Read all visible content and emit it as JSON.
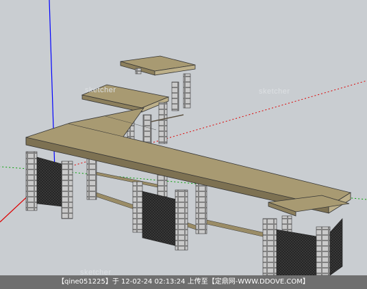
{
  "scene": {
    "background_color": "#c9cdd1",
    "wood_color": "#a89a72",
    "brick_color": "#bcbcbc",
    "mesh_color": "#2e2e2e",
    "axis_colors": {
      "blue": "#0000ff",
      "green": "#00a000",
      "red": "#dd0000"
    }
  },
  "watermarks": [
    "sketcher",
    "sketcher",
    "sketcher"
  ],
  "caption": {
    "text": "【qine051225】于 12-02-24 02:13:24 上传至【定鼎网-WWW.DDOVE.COM】"
  }
}
